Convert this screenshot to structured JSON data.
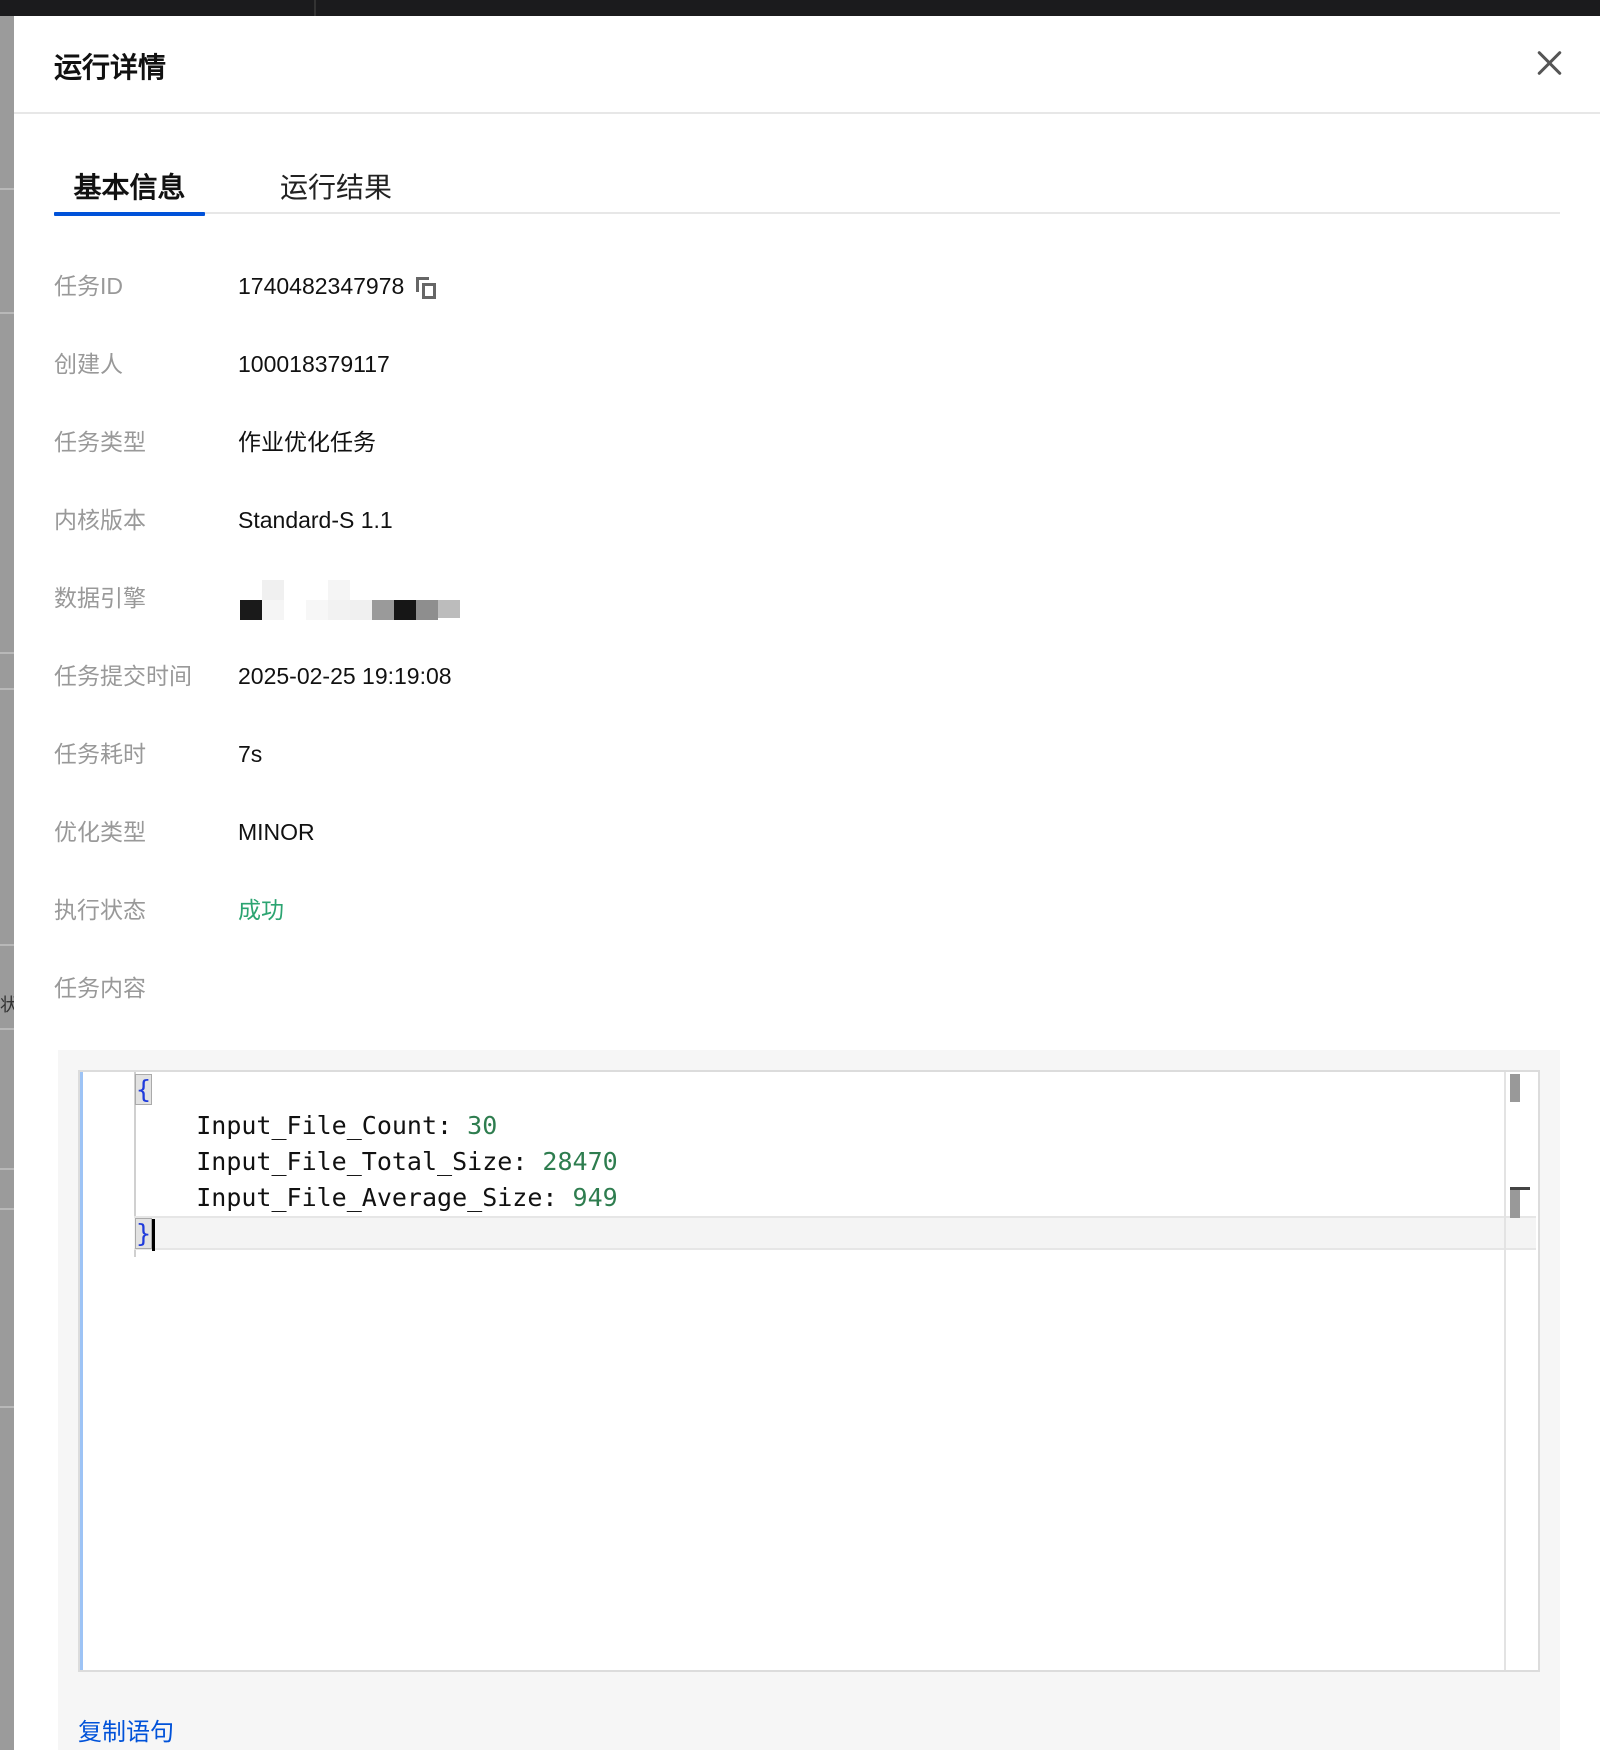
{
  "drawer": {
    "title": "运行详情"
  },
  "tabs": [
    {
      "label": "基本信息",
      "active": true
    },
    {
      "label": "运行结果",
      "active": false
    }
  ],
  "info": {
    "task_id": {
      "label": "任务ID",
      "value": "1740482347978"
    },
    "creator": {
      "label": "创建人",
      "value": "100018379117"
    },
    "task_type": {
      "label": "任务类型",
      "value": "作业优化任务"
    },
    "kernel_version": {
      "label": "内核版本",
      "value": "Standard-S 1.1"
    },
    "data_engine": {
      "label": "数据引擎"
    },
    "submit_time": {
      "label": "任务提交时间",
      "value": "2025-02-25 19:19:08"
    },
    "duration": {
      "label": "任务耗时",
      "value": "7s"
    },
    "optimize_type": {
      "label": "优化类型",
      "value": "MINOR"
    },
    "exec_status": {
      "label": "执行状态",
      "value": "成功"
    },
    "task_content": {
      "label": "任务内容"
    }
  },
  "code": {
    "open_brace": "{",
    "close_brace": "}",
    "entries": [
      {
        "key": "Input_File_Count:",
        "value": "30"
      },
      {
        "key": "Input_File_Total_Size:",
        "value": "28470"
      },
      {
        "key": "Input_File_Average_Size:",
        "value": "949"
      }
    ]
  },
  "actions": {
    "copy_statement": "复制语句"
  },
  "colors": {
    "primary": "#0052d9",
    "success": "#2ba471",
    "label": "#999999",
    "code_number": "#2e7d4f",
    "code_brace": "#1f3bdc"
  },
  "backdrop": {
    "fragment_text": "状"
  },
  "icons": {
    "close": "close-icon",
    "copy": "copy-icon"
  }
}
